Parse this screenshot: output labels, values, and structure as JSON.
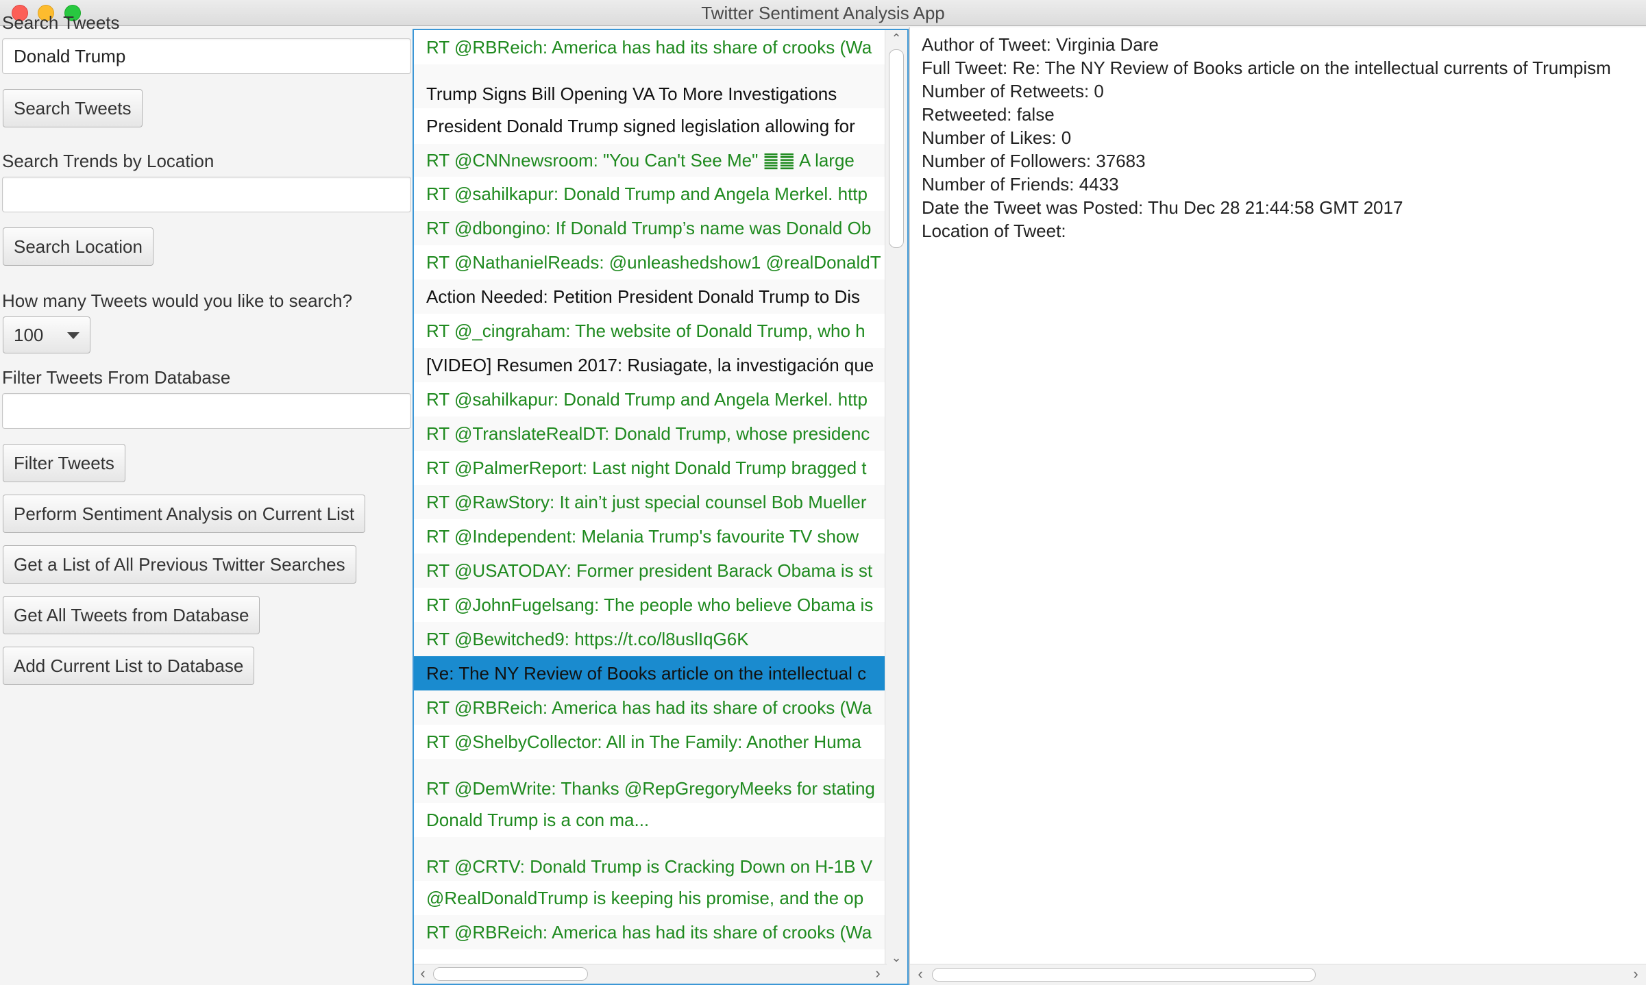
{
  "window": {
    "title": "Twitter Sentiment Analysis App"
  },
  "left": {
    "search_tweets_label": "Search Tweets",
    "search_tweets_value": "Donald Trump",
    "search_tweets_button": "Search Tweets",
    "trends_label": "Search Trends by Location",
    "trends_value": "",
    "search_location_button": "Search Location",
    "count_label": "How many Tweets would you like to search?",
    "count_value": "100",
    "filter_label": "Filter Tweets From Database",
    "filter_value": "",
    "filter_button": "Filter Tweets",
    "sentiment_button": "Perform Sentiment Analysis on Current List",
    "previous_searches_button": "Get a List of All Previous Twitter Searches",
    "all_tweets_button": "Get All Tweets from Database",
    "add_list_button": "Add Current List to Database"
  },
  "tweets": [
    {
      "text": "RT @RBReich: America has had its share of crooks (Wa",
      "color": "green"
    },
    {
      "text": "Trump Signs Bill Opening VA To More Investigations",
      "color": "black"
    },
    {
      "text": "President Donald Trump signed legislation allowing for",
      "color": "black"
    },
    {
      "text": "RT @CNNnewsroom: \"You Can't See Me\" ䷀䷀ A large",
      "color": "green"
    },
    {
      "text": "RT @sahilkapur: Donald Trump and Angela Merkel. http",
      "color": "green"
    },
    {
      "text": "RT @dbongino: If Donald Trump’s name was Donald Ob",
      "color": "green"
    },
    {
      "text": "RT @NathanielReads: @unleashedshow1 @realDonaldT",
      "color": "green"
    },
    {
      "text": "Action Needed: Petition President Donald Trump to Dis",
      "color": "black"
    },
    {
      "text": "RT @_cingraham: The website of Donald Trump, who h",
      "color": "green"
    },
    {
      "text": "[VIDEO] Resumen 2017: Rusiagate, la investigación que",
      "color": "black"
    },
    {
      "text": "RT @sahilkapur: Donald Trump and Angela Merkel. http",
      "color": "green"
    },
    {
      "text": "RT @TranslateRealDT: Donald Trump, whose presidenc",
      "color": "green"
    },
    {
      "text": "RT @PalmerReport: Last night Donald Trump bragged t",
      "color": "green"
    },
    {
      "text": "RT @RawStory: It ain’t just special counsel Bob Mueller",
      "color": "green"
    },
    {
      "text": "RT @Independent: Melania Trump's favourite TV show",
      "color": "green"
    },
    {
      "text": "RT @USATODAY: Former president Barack Obama is st",
      "color": "green"
    },
    {
      "text": "RT @JohnFugelsang: The people who believe Obama is",
      "color": "green"
    },
    {
      "text": "RT @Bewitched9: https://t.co/l8uslIqG6K",
      "color": "green"
    },
    {
      "text": "Re: The NY Review of Books article on the intellectual c",
      "color": "black"
    },
    {
      "text": "RT @RBReich: America has had its share of crooks (Wa",
      "color": "green"
    },
    {
      "text": "RT @ShelbyCollector: All in The Family: Another Huma",
      "color": "green"
    },
    {
      "text": "RT @DemWrite: Thanks @RepGregoryMeeks for stating",
      "color": "green"
    },
    {
      "text": "Donald Trump is a con ma...",
      "color": "green"
    },
    {
      "text": "RT @CRTV: Donald Trump is Cracking Down on H-1B V",
      "color": "green"
    },
    {
      "text": "@RealDonaldTrump is keeping his promise, and the op",
      "color": "green"
    },
    {
      "text": "RT @RBReich: America has had its share of crooks (Wa",
      "color": "green"
    }
  ],
  "selected_index": 18,
  "detail": {
    "author": "Author of Tweet: Virginia Dare",
    "full_tweet": "Full Tweet: Re: The NY Review of Books article on the intellectual currents of Trumpism",
    "retweets": "Number of Retweets: 0",
    "retweeted": "Retweeted: false",
    "likes": "Number of Likes: 0",
    "followers": "Number of Followers: 37683",
    "friends": "Number of Friends: 4433",
    "date": "Date the Tweet was Posted: Thu Dec 28 21:44:58 GMT 2017",
    "location": "Location of Tweet:"
  },
  "colors": {
    "green": "#1f8a1f",
    "selected": "#1a8bcf",
    "focus": "#3c97d6"
  }
}
